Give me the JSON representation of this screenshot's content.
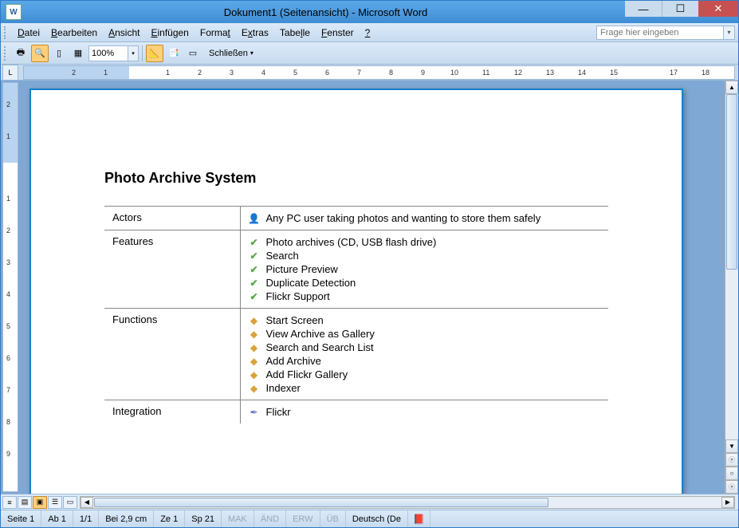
{
  "titlebar": {
    "title": "Dokument1 (Seitenansicht) - Microsoft Word"
  },
  "menubar": {
    "items": [
      "Datei",
      "Bearbeiten",
      "Ansicht",
      "Einfügen",
      "Format",
      "Extras",
      "Tabelle",
      "Fenster",
      "?"
    ],
    "question_placeholder": "Frage hier eingeben"
  },
  "toolbar": {
    "zoom": "100%",
    "close_label": "Schließen"
  },
  "ruler_corner": "L",
  "document": {
    "heading": "Photo Archive System",
    "rows": [
      {
        "label": "Actors",
        "icon": "actor",
        "items": [
          "Any PC user taking photos and wanting to store them safely"
        ]
      },
      {
        "label": "Features",
        "icon": "check",
        "items": [
          "Photo archives (CD, USB flash drive)",
          "Search",
          "Picture Preview",
          "Duplicate Detection",
          "Flickr Support"
        ]
      },
      {
        "label": "Functions",
        "icon": "cube",
        "items": [
          "Start Screen",
          "View Archive as Gallery",
          "Search and Search List",
          "Add Archive",
          "Add Flickr Gallery",
          "Indexer"
        ]
      },
      {
        "label": "Integration",
        "icon": "feather",
        "items": [
          "Flickr"
        ]
      }
    ]
  },
  "statusbar": {
    "seite_label": "Seite",
    "seite_val": "1",
    "ab_label": "Ab",
    "ab_val": "1",
    "pages": "1/1",
    "bei_label": "Bei",
    "bei_val": "2,9 cm",
    "ze_label": "Ze",
    "ze_val": "1",
    "sp_label": "Sp",
    "sp_val": "21",
    "mak": "MAK",
    "and": "ÄND",
    "erw": "ERW",
    "ub": "ÜB",
    "lang": "Deutsch (De"
  }
}
